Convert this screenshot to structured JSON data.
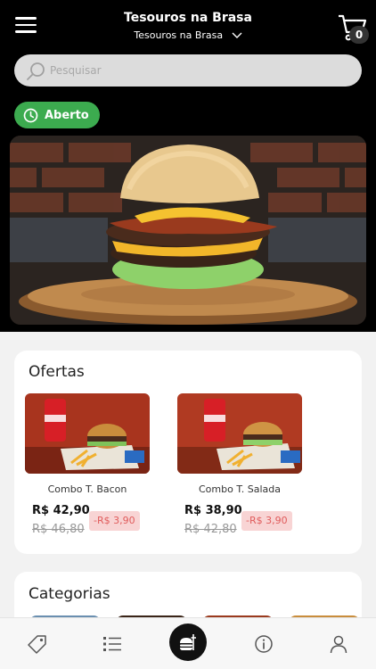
{
  "header": {
    "title": "Tesouros na Brasa",
    "store_selector": "Tesouros na Brasa",
    "cart_count": "0"
  },
  "search": {
    "placeholder": "Pesquisar",
    "value": ""
  },
  "status": {
    "label": "Aberto",
    "color": "#3cab4f"
  },
  "offers": {
    "title": "Ofertas",
    "items": [
      {
        "name": "Combo T. Bacon",
        "price": "R$ 42,90",
        "old_price": "R$ 46,80",
        "discount": "-R$ 3,90"
      },
      {
        "name": "Combo T. Salada",
        "price": "R$ 38,90",
        "old_price": "R$ 42,80",
        "discount": "-R$ 3,90"
      }
    ]
  },
  "categories": {
    "title": "Categorias"
  },
  "bottom_nav": {
    "icons": [
      "tag-icon",
      "list-icon",
      "food-icon",
      "info-icon",
      "user-icon"
    ],
    "active": "food-icon"
  },
  "colors": {
    "header_bg": "#000000",
    "status_green": "#3cab4f",
    "discount_bg": "#f8d4d4",
    "discount_text": "#e05b5b"
  }
}
